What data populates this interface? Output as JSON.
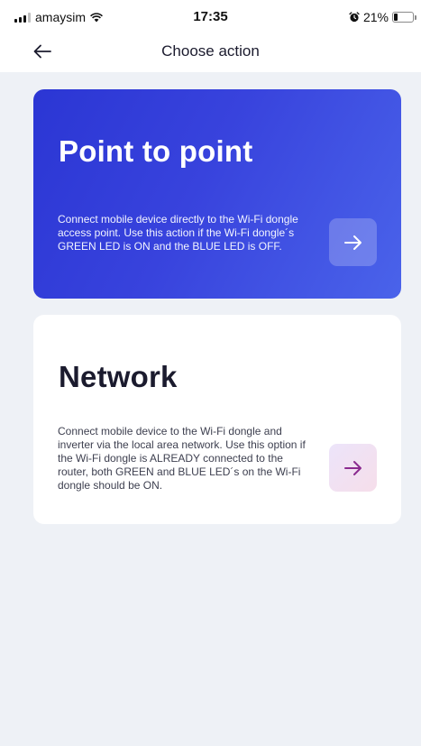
{
  "status_bar": {
    "carrier": "amaysim",
    "time": "17:35",
    "battery": "21%",
    "battery_level": 0.21
  },
  "header": {
    "title": "Choose action",
    "back_icon": "arrow-left-icon"
  },
  "cards": [
    {
      "id": "point-to-point",
      "title": "Point to point",
      "description": "Connect mobile device directly to the Wi-Fi dongle access point. Use this action if the Wi-Fi dongle´s GREEN LED is ON and the BLUE LED is OFF.",
      "icon": "arrow-right-icon"
    },
    {
      "id": "network",
      "title": "Network",
      "description": "Connect mobile device to the Wi-Fi dongle and inverter via the local area network. Use this option if the Wi-Fi dongle is ALREADY connected to the router, both GREEN and BLUE LED´s on the Wi-Fi dongle should be ON.",
      "icon": "arrow-right-icon"
    }
  ],
  "colors": {
    "background": "#eef1f6",
    "card_primary_start": "#2b36d4",
    "card_primary_end": "#4a63ea",
    "network_arrow": "#8a2a8f"
  }
}
